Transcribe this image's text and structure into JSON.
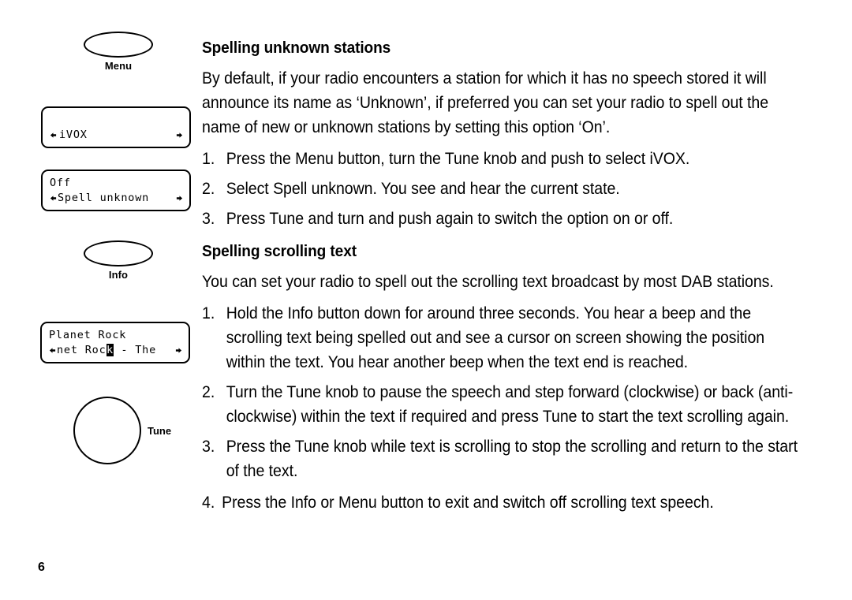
{
  "page": {
    "folio": "6"
  },
  "illustrations": {
    "menu_button": {
      "label": "Menu",
      "icon": "oval-push-button-icon"
    },
    "info_button": {
      "label": "Info",
      "icon": "oval-push-button-icon"
    },
    "tune_knob": {
      "label": "Tune",
      "icon": "rotary-knob-icon"
    },
    "screens": [
      {
        "id": "screen-ivox",
        "line1": "",
        "line2_left_arrow": "◀",
        "line2": "iVOX",
        "line2_right_arrow": "▶"
      },
      {
        "id": "screen-spell-unknown",
        "line1": "Off",
        "line2_left_arrow": "◀",
        "line2": "Spell unknown",
        "line2_right_arrow": "▶"
      },
      {
        "id": "screen-planet-rock",
        "line1": "Planet Rock",
        "line2_left_arrow": "◀",
        "line2_before_cursor": "net Roc",
        "line2_cursor_char": "k",
        "line2_after_cursor": " - The",
        "line2_right_arrow": "▶"
      }
    ]
  },
  "content": {
    "heading_1": "Spelling unknown stations",
    "intro_1": "By default, if your radio encounters a station for which it has no speech stored it will announce its name as ‘Unknown’, if preferred you can set your radio to spell out the name of new or unknown stations by setting this option ‘On’.",
    "steps_1": [
      {
        "marker": "1.",
        "text": "Press the Menu button, turn the Tune knob and push to select iVOX."
      },
      {
        "marker": "2.",
        "text": "Select Spell unknown. You see and hear the current state."
      },
      {
        "marker": "3.",
        "text": "Press Tune and turn and push again to switch the option on or off."
      }
    ],
    "heading_2": "Spelling scrolling text",
    "intro_2": "You can set your radio to spell out the scrolling text broadcast by most DAB stations.",
    "steps_2": [
      {
        "marker": "1.",
        "text": "Hold the Info button down for around three seconds. You hear a beep and the scrolling text being spelled out and see a cursor on screen showing the position within the text. You hear another beep when the text end is reached."
      },
      {
        "marker": "2.",
        "text": "Turn the Tune knob to pause the speech and step forward (clockwise) or back (anti-clockwise) within the text if required and press Tune to start the text scrolling again."
      },
      {
        "marker": "3.",
        "text": "Press the Tune knob while text is scrolling to stop the scrolling and return to the start of the text."
      }
    ],
    "steps_3": [
      {
        "marker": "4.",
        "text": "Press the Info or Menu button to exit and switch off scrolling text speech."
      }
    ]
  },
  "colors": {
    "ink": "#000000",
    "paper": "#ffffff"
  }
}
